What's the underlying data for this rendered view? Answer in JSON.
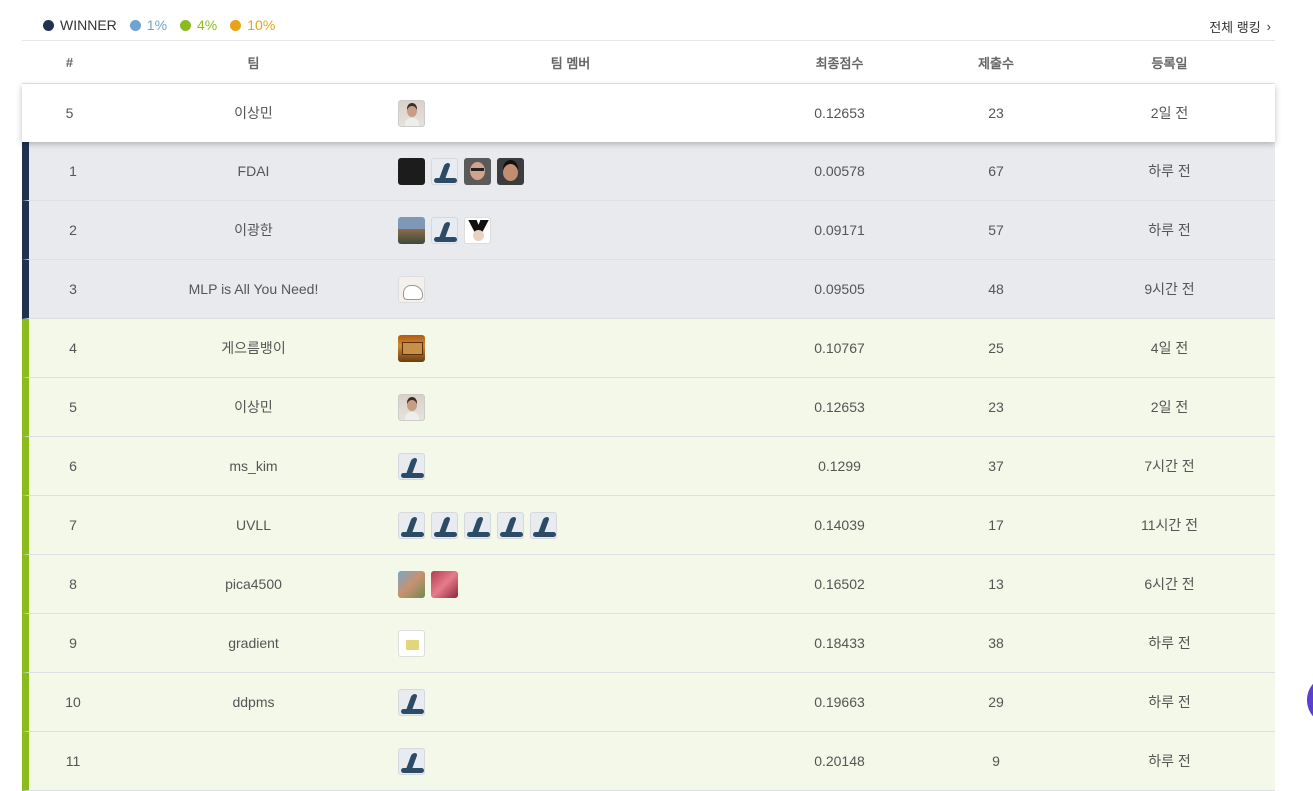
{
  "legend": {
    "items": [
      {
        "label": "WINNER",
        "color": "#1f3350",
        "text_color": "#333333"
      },
      {
        "label": "1%",
        "color": "#6fa3d2",
        "text_color": "#6fa3d2"
      },
      {
        "label": "4%",
        "color": "#8cbb1e",
        "text_color": "#8cbb1e"
      },
      {
        "label": "10%",
        "color": "#e8a316",
        "text_color": "#e8a316"
      }
    ],
    "full_ranking_label": "전체 랭킹",
    "chevron": "›"
  },
  "table": {
    "headers": {
      "rank": "#",
      "team": "팀",
      "members": "팀 멤버",
      "score": "최종점수",
      "submissions": "제출수",
      "date": "등록일"
    },
    "my_row": {
      "rank": "5",
      "team": "이상민",
      "score": "0.12653",
      "submissions": "23",
      "date": "2일 전",
      "avatars": [
        "person"
      ]
    },
    "rows": [
      {
        "rank": "1",
        "team": "FDAI",
        "score": "0.00578",
        "submissions": "67",
        "date": "하루 전",
        "tier": "winner",
        "avatars": [
          "black",
          "wave",
          "man",
          "man2"
        ]
      },
      {
        "rank": "2",
        "team": "이광한",
        "score": "0.09171",
        "submissions": "57",
        "date": "하루 전",
        "tier": "winner",
        "avatars": [
          "scene",
          "wave",
          "panda"
        ]
      },
      {
        "rank": "3",
        "team": "MLP is All You Need!",
        "score": "0.09505",
        "submissions": "48",
        "date": "9시간 전",
        "tier": "winner",
        "avatars": [
          "dino"
        ]
      },
      {
        "rank": "4",
        "team": "게으름뱅이",
        "score": "0.10767",
        "submissions": "25",
        "date": "4일 전",
        "tier": "tier4",
        "avatars": [
          "box"
        ]
      },
      {
        "rank": "5",
        "team": "이상민",
        "score": "0.12653",
        "submissions": "23",
        "date": "2일 전",
        "tier": "tier4",
        "avatars": [
          "person"
        ]
      },
      {
        "rank": "6",
        "team": "ms_kim",
        "score": "0.1299",
        "submissions": "37",
        "date": "7시간 전",
        "tier": "tier4",
        "avatars": [
          "wave"
        ]
      },
      {
        "rank": "7",
        "team": "UVLL",
        "score": "0.14039",
        "submissions": "17",
        "date": "11시간 전",
        "tier": "tier4",
        "avatars": [
          "wave",
          "wave",
          "wave",
          "wave",
          "wave"
        ]
      },
      {
        "rank": "8",
        "team": "pica4500",
        "score": "0.16502",
        "submissions": "13",
        "date": "6시간 전",
        "tier": "tier4",
        "avatars": [
          "anime",
          "pink"
        ]
      },
      {
        "rank": "9",
        "team": "gradient",
        "score": "0.18433",
        "submissions": "38",
        "date": "하루 전",
        "tier": "tier4",
        "avatars": [
          "folder"
        ]
      },
      {
        "rank": "10",
        "team": "ddpms",
        "score": "0.19663",
        "submissions": "29",
        "date": "하루 전",
        "tier": "tier4",
        "avatars": [
          "wave"
        ]
      },
      {
        "rank": "11",
        "team": "",
        "score": "0.20148",
        "submissions": "9",
        "date": "하루 전",
        "tier": "tier4",
        "avatars": [
          "wave"
        ]
      }
    ]
  }
}
